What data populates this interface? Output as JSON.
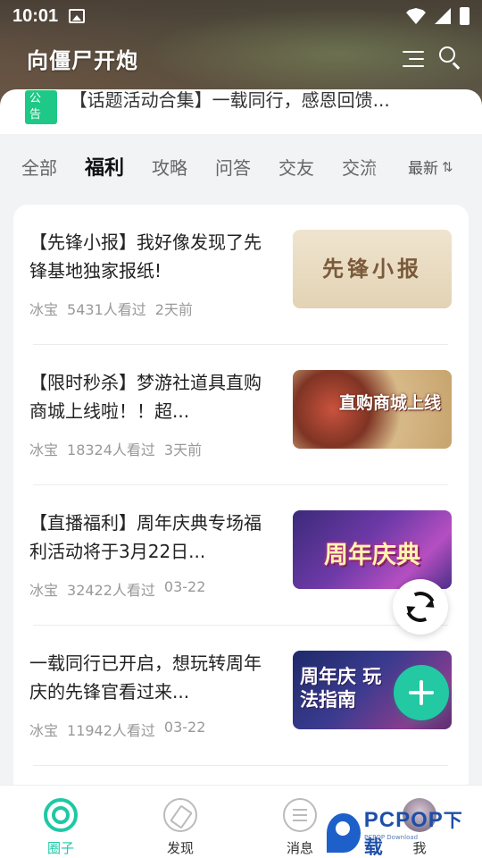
{
  "status_bar": {
    "time": "10:01"
  },
  "header": {
    "title": "向僵尸开炮"
  },
  "notice": {
    "badge": "公告",
    "text": "【话题活动合集】一载同行，感恩回馈..."
  },
  "tabs": {
    "items": [
      {
        "label": "全部"
      },
      {
        "label": "福利",
        "active": true
      },
      {
        "label": "攻略"
      },
      {
        "label": "问答"
      },
      {
        "label": "交友"
      },
      {
        "label": "交流"
      }
    ],
    "sort_label": "最新",
    "sort_icon": "sort-icon"
  },
  "articles": [
    {
      "title": "【先锋小报】我好像发现了先锋基地独家报纸!",
      "author": "冰宝",
      "views": "5431人看过",
      "time": "2天前",
      "thumb_caption": "先锋小报"
    },
    {
      "title": "【限时秒杀】梦游社道具直购商城上线啦！！超...",
      "author": "冰宝",
      "views": "18324人看过",
      "time": "3天前",
      "thumb_caption": "直购商城上线"
    },
    {
      "title": "【直播福利】周年庆典专场福利活动将于3月22日...",
      "author": "冰宝",
      "views": "32422人看过",
      "time": "03-22",
      "thumb_caption": "周年庆典"
    },
    {
      "title": "一载同行已开启，想玩转周年庆的先锋官看过来...",
      "author": "冰宝",
      "views": "11942人看过",
      "time": "03-22",
      "thumb_caption": "周年庆 玩法指南"
    }
  ],
  "bottom_nav": [
    {
      "label": "圈子",
      "icon": "home-circle-icon",
      "active": true
    },
    {
      "label": "发现",
      "icon": "compass-icon"
    },
    {
      "label": "消息",
      "icon": "message-icon"
    },
    {
      "label": "我",
      "icon": "avatar-icon"
    }
  ],
  "watermark": {
    "brand": "PCPOP",
    "brand_cn": "下载",
    "sub": "PCPOP Download"
  },
  "colors": {
    "accent": "#1dc9a4",
    "badge": "#1ec886",
    "fab": "#22c9a3"
  }
}
